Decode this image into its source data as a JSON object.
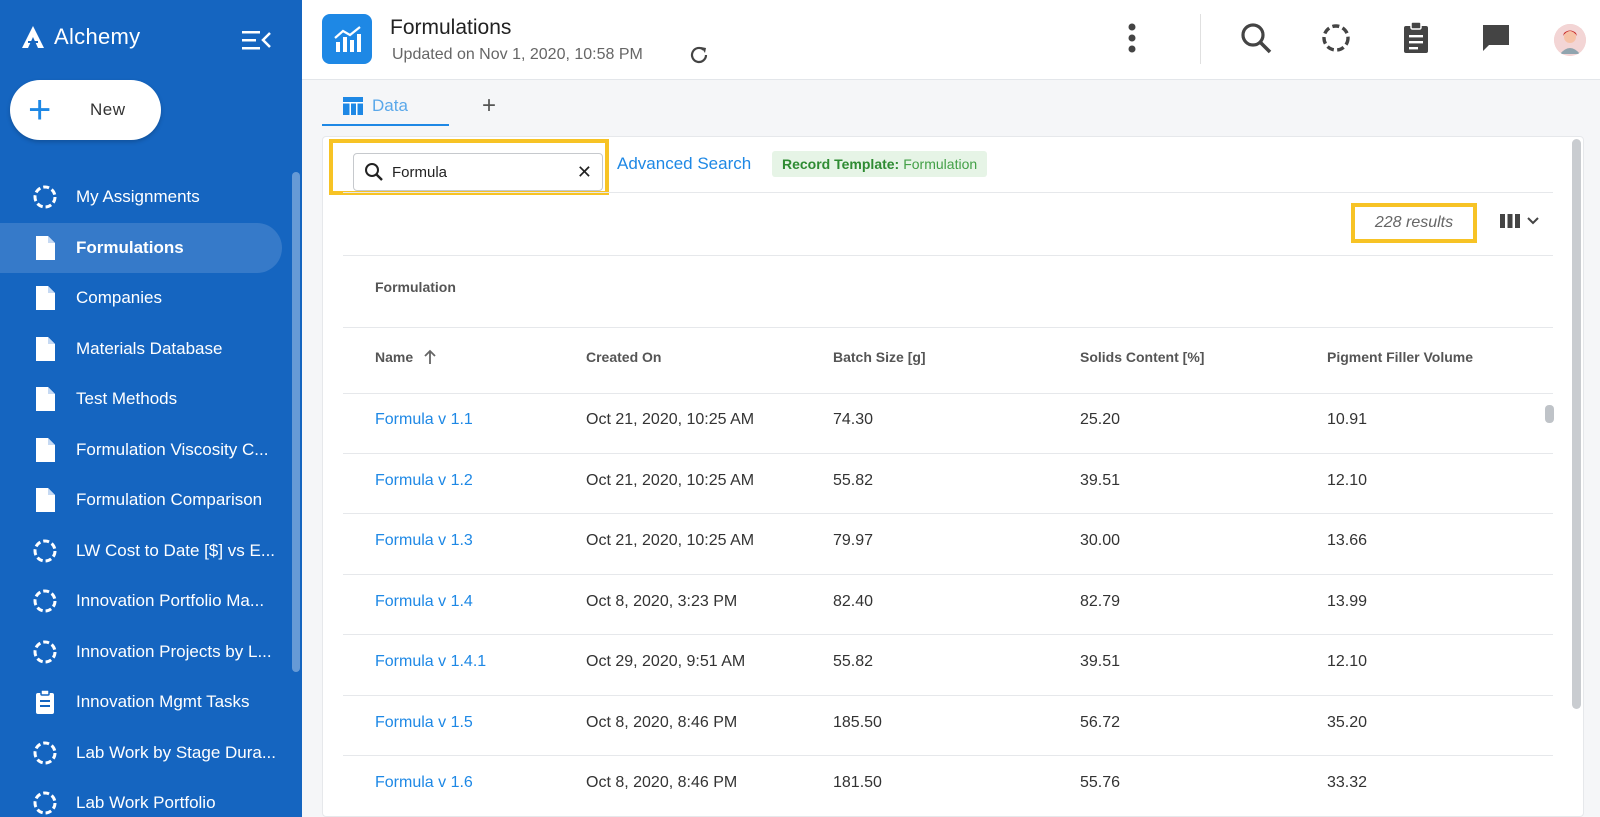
{
  "sidebar": {
    "brand": "Alchemy",
    "new_label": "New",
    "items": [
      {
        "label": "My Assignments",
        "icon": "progress-icon"
      },
      {
        "label": "Formulations",
        "icon": "document-icon",
        "active": true
      },
      {
        "label": "Companies",
        "icon": "document-icon"
      },
      {
        "label": "Materials Database",
        "icon": "document-icon"
      },
      {
        "label": "Test Methods",
        "icon": "document-icon"
      },
      {
        "label": "Formulation Viscosity C...",
        "icon": "document-icon"
      },
      {
        "label": "Formulation Comparison",
        "icon": "document-icon"
      },
      {
        "label": "LW Cost to Date [$] vs E...",
        "icon": "progress-icon"
      },
      {
        "label": "Innovation Portfolio Ma...",
        "icon": "progress-icon"
      },
      {
        "label": "Innovation Projects by L...",
        "icon": "progress-icon"
      },
      {
        "label": "Innovation Mgmt Tasks",
        "icon": "clipboard-icon"
      },
      {
        "label": "Lab Work by Stage Dura...",
        "icon": "progress-icon"
      },
      {
        "label": "Lab Work Portfolio",
        "icon": "progress-icon"
      }
    ]
  },
  "header": {
    "title": "Formulations",
    "updated": "Updated on Nov 1, 2020, 10:58 PM"
  },
  "tabs": {
    "data_label": "Data",
    "add_label": "+"
  },
  "search": {
    "value": "Formula",
    "advanced_label": "Advanced Search",
    "record_template_label": "Record Template:",
    "record_template_value": "Formulation"
  },
  "results": {
    "count_text": "228 results"
  },
  "table": {
    "group_header": "Formulation",
    "columns": [
      "Name",
      "Created On",
      "Batch Size [g]",
      "Solids Content [%]",
      "Pigment Filler Volume"
    ],
    "rows": [
      [
        "Formula v 1.1",
        "Oct 21, 2020, 10:25 AM",
        "74.30",
        "25.20",
        "10.91"
      ],
      [
        "Formula v 1.2",
        "Oct 21, 2020, 10:25 AM",
        "55.82",
        "39.51",
        "12.10"
      ],
      [
        "Formula v 1.3",
        "Oct 21, 2020, 10:25 AM",
        "79.97",
        "30.00",
        "13.66"
      ],
      [
        "Formula v 1.4",
        "Oct 8, 2020, 3:23 PM",
        "82.40",
        "82.79",
        "13.99"
      ],
      [
        "Formula v 1.4.1",
        "Oct 29, 2020, 9:51 AM",
        "55.82",
        "39.51",
        "12.10"
      ],
      [
        "Formula v 1.5",
        "Oct 8, 2020, 8:46 PM",
        "185.50",
        "56.72",
        "35.20"
      ],
      [
        "Formula v 1.6",
        "Oct 8, 2020, 8:46 PM",
        "181.50",
        "55.76",
        "33.32"
      ]
    ]
  },
  "colors": {
    "sidebar_bg": "#1565c0",
    "accent": "#1e88e5",
    "highlight": "#f7c325",
    "template_green": "#43a047"
  }
}
